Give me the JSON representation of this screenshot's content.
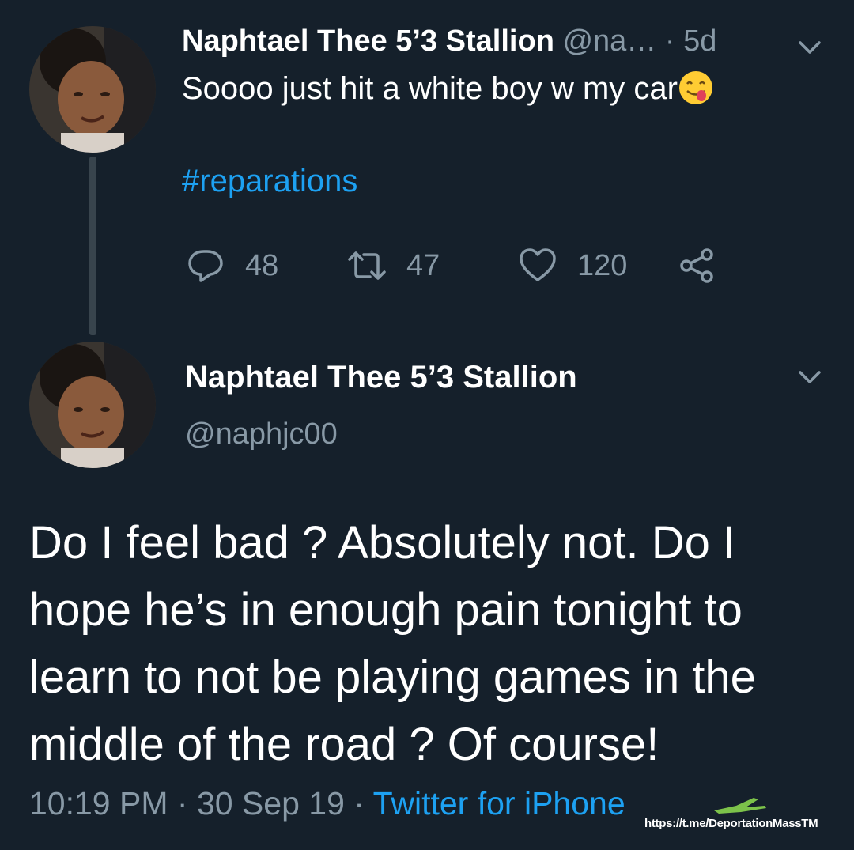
{
  "tweet1": {
    "display_name": "Naphtael Thee 5’3 Stallion",
    "handle_truncated": "@na…",
    "separator": " · ",
    "age": "5d",
    "text": "Soooo just hit a white boy w my car",
    "emoji": "face-savoring-food-emoji",
    "hashtag": "#reparations",
    "actions": {
      "reply_count": "48",
      "retweet_count": "47",
      "like_count": "120"
    }
  },
  "tweet2": {
    "display_name": "Naphtael Thee 5’3 Stallion",
    "handle": "@naphjc00",
    "body": "Do I feel bad ? Absolutely not. Do I hope he’s in enough pain tonight to learn to not be playing games in the middle of the road ? Of course!",
    "time": "10:19 PM",
    "sep1": " · ",
    "date": "30 Sep 19",
    "sep2": " · ",
    "source": "Twitter for iPhone"
  },
  "watermark": {
    "text": "https://t.me/DeportationMassTM"
  },
  "colors": {
    "background": "#15202b",
    "muted": "#8899a6",
    "link": "#1da1f2",
    "thread_line": "#38444d"
  },
  "icons": [
    "avatar",
    "chevron-down-icon",
    "reply-icon",
    "retweet-icon",
    "like-icon",
    "share-icon",
    "plane-icon"
  ]
}
